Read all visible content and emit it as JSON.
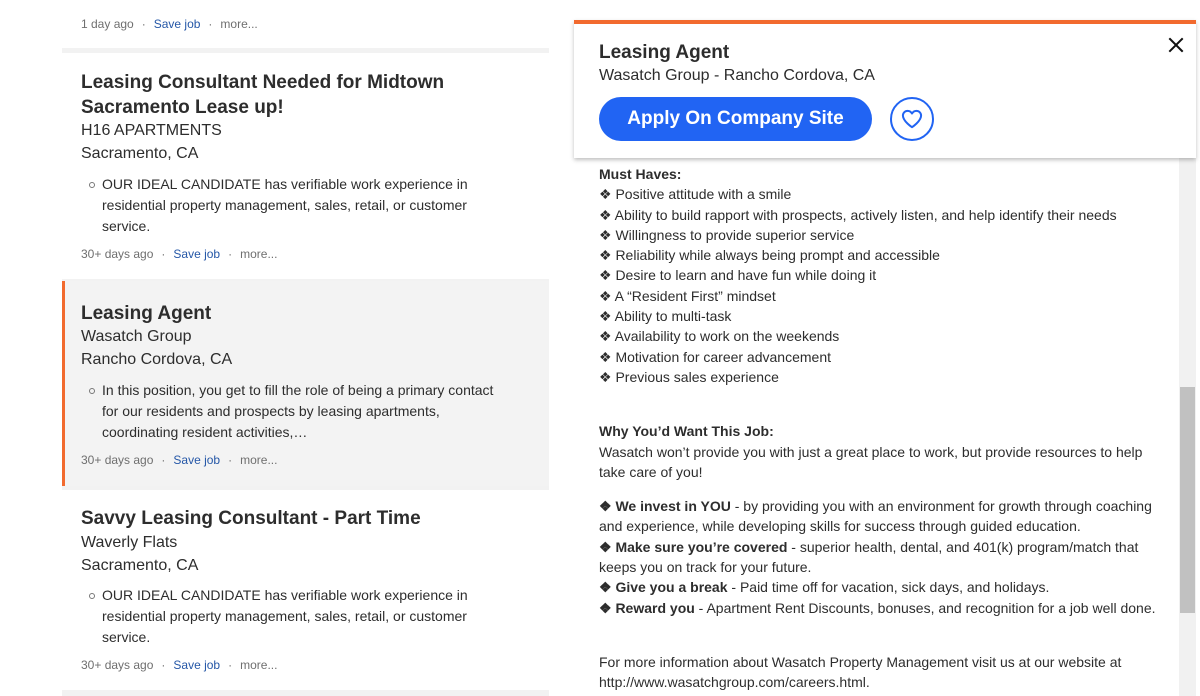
{
  "job_list": [
    {
      "title": "",
      "company": "",
      "location": "",
      "snippet": "",
      "posted": "1 day ago",
      "save_label": "Save job",
      "more_label": "more..."
    },
    {
      "title": "Leasing Consultant Needed for Midtown Sacramento Lease up!",
      "company": "H16 APARTMENTS",
      "location": "Sacramento, CA",
      "snippet": "OUR IDEAL CANDIDATE has verifiable work experience in residential property management, sales, retail, or customer service.",
      "posted": "30+ days ago",
      "save_label": "Save job",
      "more_label": "more..."
    },
    {
      "title": "Leasing Agent",
      "company": "Wasatch Group",
      "location": "Rancho Cordova, CA",
      "snippet": "In this position, you get to fill the role of being a primary contact for our residents and prospects by leasing apartments, coordinating resident activities,…",
      "posted": "30+ days ago",
      "save_label": "Save job",
      "more_label": "more...",
      "selected": true
    },
    {
      "title": "Savvy Leasing Consultant - Part Time",
      "company": "Waverly Flats",
      "location": "Sacramento, CA",
      "snippet": "OUR IDEAL CANDIDATE has verifiable work experience in residential property management, sales, retail, or customer service.",
      "posted": "30+ days ago",
      "save_label": "Save job",
      "more_label": "more..."
    }
  ],
  "separator": "·",
  "detail": {
    "title": "Leasing Agent",
    "subtitle": "Wasatch Group - Rancho Cordova, CA",
    "apply_label": "Apply On Company Site",
    "must_haves_title": "Must Haves:",
    "must_haves": [
      "❖ Positive attitude with a smile",
      "❖ Ability to build rapport with prospects, actively listen, and help identify their needs",
      "❖ Willingness to provide superior service",
      "❖ Reliability while always being prompt and accessible",
      "❖ Desire to learn and have fun while doing it",
      "❖ A “Resident First” mindset",
      "❖ Ability to multi-task",
      "❖ Availability to work on the weekends",
      "❖ Motivation for career advancement",
      "❖ Previous sales experience"
    ],
    "why_title": "Why You’d Want This Job:",
    "why_text": "Wasatch won’t provide you with just a great place to work, but provide resources to help take care of you!",
    "benefits": [
      {
        "bold": "❖ We invest in YOU",
        "text": " - by providing you with an environment for growth through coaching and experience, while developing skills for success through guided education."
      },
      {
        "bold": "❖ Make sure you’re covered",
        "text": " - superior health, dental, and 401(k) program/match that keeps you on track for your future."
      },
      {
        "bold": "❖ Give you a break",
        "text": " - Paid time off for vacation, sick days, and holidays."
      },
      {
        "bold": "❖ Reward you",
        "text": " - Apartment Rent Discounts, bonuses, and recognition for a job well done."
      }
    ],
    "more_info": "For more information about Wasatch Property Management visit us at our website at http://www.wasatchgroup.com/careers.html."
  },
  "icons": {
    "close": "close-icon",
    "favorite": "heart-icon"
  },
  "colors": {
    "accent_orange": "#f26a2e",
    "apply_blue": "#2164f3",
    "link_blue": "#2557a7"
  }
}
